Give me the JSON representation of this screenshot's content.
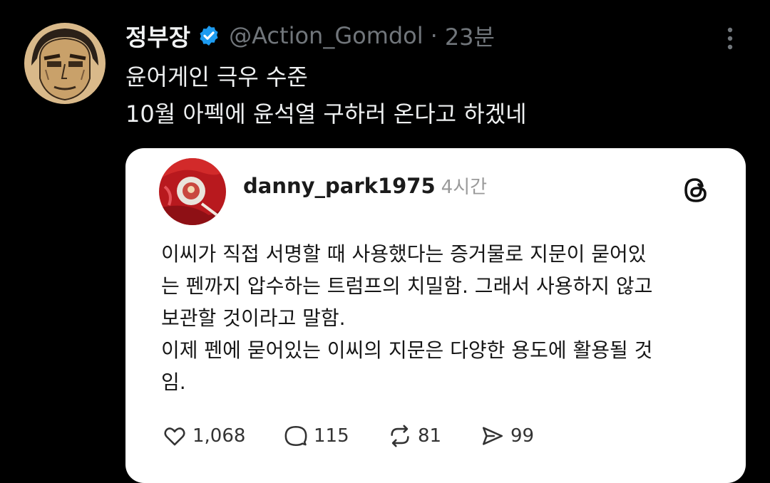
{
  "tweet": {
    "display_name": "정부장",
    "handle": "@Action_Gomdol",
    "separator": "·",
    "time": "23분",
    "lines": [
      "윤어게인 극우 수준",
      "10월 아펙에 윤석열 구하러 온다고 하겠네"
    ],
    "icons": {
      "avatar": "avatar-illustration",
      "verified": "verified-badge-icon",
      "more": "more-vertical-icon"
    },
    "colors": {
      "background": "#000000",
      "verified": "#1d9bf0",
      "secondary_text": "#71767b"
    }
  },
  "quoted_post": {
    "username": "danny_park1975",
    "time": "4시간",
    "platform_icon": "threads-logo-icon",
    "body_lines": [
      "이씨가 직접 서명할 때 사용했다는 증거물로 지문이 묻어있",
      "는 펜까지 압수하는 트럼프의 치밀함. 그래서 사용하지 않고",
      "보관할 것이라고 말함.",
      "이제 펜에 묻어있는 이씨의 지문은 다양한 용도에 활용될 것",
      "임."
    ],
    "stats": {
      "likes": "1,068",
      "replies": "115",
      "reposts": "81",
      "shares": "99"
    },
    "colors": {
      "card_background": "#ffffff"
    }
  }
}
